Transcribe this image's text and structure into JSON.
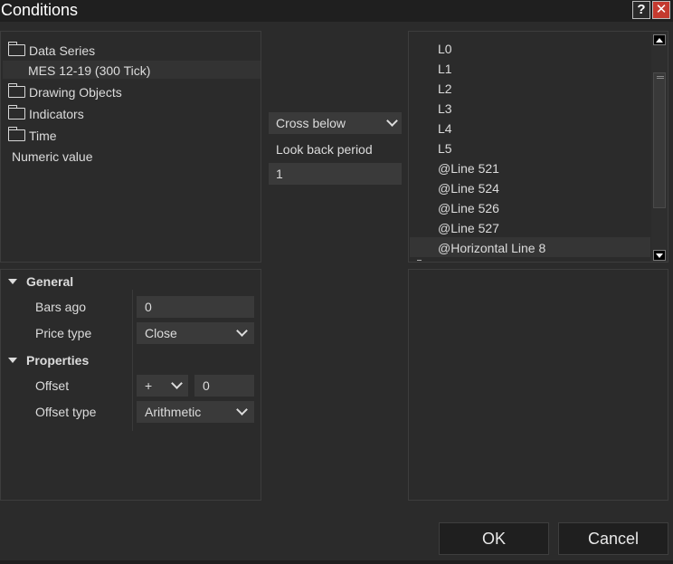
{
  "window": {
    "title": "Conditions",
    "help_label": "?",
    "close_label": "✕",
    "close_color": "#c43a2f"
  },
  "tree": {
    "items": [
      {
        "label": "Data Series",
        "icon": "folder-icon"
      },
      {
        "label": "MES 12-19 (300 Tick)",
        "selected": true
      },
      {
        "label": "Drawing Objects",
        "icon": "folder-icon"
      },
      {
        "label": "Indicators",
        "icon": "folder-icon"
      },
      {
        "label": "Time",
        "icon": "folder-icon"
      },
      {
        "label": "Numeric value"
      }
    ]
  },
  "operator": {
    "selected": "Cross below",
    "lookback_label": "Look back period",
    "lookback_value": "1"
  },
  "target_list": {
    "items": [
      "L0",
      "L1",
      "L2",
      "L3",
      "L4",
      "L5",
      "@Line 521",
      "@Line 524",
      "@Line 526",
      "@Line 527",
      "@Horizontal Line 8"
    ],
    "selected": "@Horizontal Line 8"
  },
  "properties": {
    "general_header": "General",
    "bars_ago_label": "Bars ago",
    "bars_ago_value": "0",
    "price_type_label": "Price type",
    "price_type_value": "Close",
    "properties_header": "Properties",
    "offset_label": "Offset",
    "offset_sign": "+",
    "offset_value": "0",
    "offset_type_label": "Offset type",
    "offset_type_value": "Arithmetic"
  },
  "buttons": {
    "ok": "OK",
    "cancel": "Cancel"
  }
}
